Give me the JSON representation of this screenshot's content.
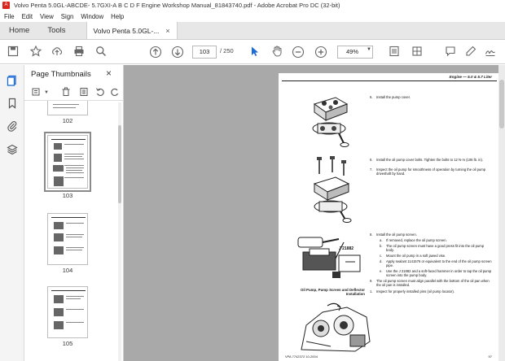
{
  "window": {
    "title": "Volvo Penta 5.0GL-ABCDE- 5.7GXI-A B C D F Engine Workshop Manual_81843740.pdf - Adobe Acrobat Pro DC (32-bit)"
  },
  "menu": [
    "File",
    "Edit",
    "View",
    "Sign",
    "Window",
    "Help"
  ],
  "tabs": {
    "home": "Home",
    "tools": "Tools",
    "doc": "Volvo Penta 5.0GL-...",
    "close": "×"
  },
  "toolbar": {
    "page_current": "103",
    "page_total": "/ 250",
    "zoom": "49%"
  },
  "thumbnails": {
    "title": "Page Thumbnails",
    "close": "×",
    "pages": [
      {
        "label": "102"
      },
      {
        "label": "103"
      },
      {
        "label": "104"
      },
      {
        "label": "105"
      }
    ]
  },
  "pdf_page": {
    "header": "Engine — 5.0 & 5.7 Liter",
    "steps": [
      {
        "num": "6.",
        "text": "Install the pump cover."
      },
      {
        "num": "6.",
        "text": "Install the oil pump cover bolts. Tighten the bolts to 12 N·m (106 lb. in)."
      },
      {
        "num": "7.",
        "text": "Inspect the oil pump for smoothness of operation by turning the oil pump driveshaft by hand."
      },
      {
        "num": "8.",
        "text": "Install the oil pump screen."
      },
      {
        "num": "a.",
        "text": "If removed, replace the oil pump screen."
      },
      {
        "num": "b.",
        "text": "The oil pump screen must have a good press fit into the oil pump body."
      },
      {
        "num": "c.",
        "text": "Mount the oil pump in a soft jawed vise."
      },
      {
        "num": "d.",
        "text": "Apply sealant 1141576 or equivalent to the end of the oil pump screen pipe."
      },
      {
        "num": "e.",
        "text": "Use the J 21882 and a soft-faced hammer in order to tap the oil pump screen into the pump body."
      },
      {
        "num": "9.",
        "text": "The oil pump screen must align parallel with the bottom of the oil pan when the oil pan is installed."
      },
      {
        "num": "1.",
        "text": "Inspect for properly installed pins (oil pump locator)."
      }
    ],
    "section_heading": "Oil Pump, Pump Screen and Deflector Installation",
    "tool_label": "J 21882",
    "footer_left": "VPA 7742372 10-2004",
    "footer_right": "97"
  }
}
